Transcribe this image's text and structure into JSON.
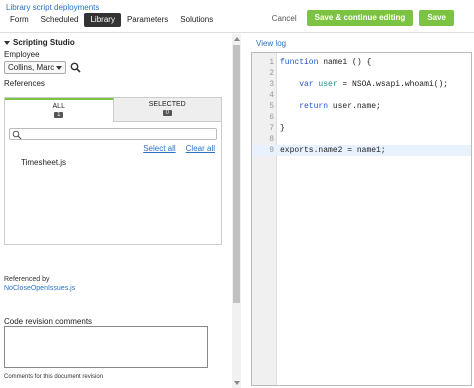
{
  "header": {
    "breadcrumb": "Library script deployments",
    "tabs": [
      "Form",
      "Scheduled",
      "Library",
      "Parameters",
      "Solutions"
    ],
    "active_tab": "Library",
    "cancel_label": "Cancel",
    "save_continue_label": "Save & continue editing",
    "save_label": "Save"
  },
  "left": {
    "section_title": "Scripting Studio",
    "employee_label": "Employee",
    "employee_value": "Collins, Marc",
    "references_label": "References",
    "ref_tabs": [
      {
        "label": "ALL",
        "count": "1"
      },
      {
        "label": "SELECTED",
        "count": "0"
      }
    ],
    "select_all": "Select all",
    "clear_all": "Clear all",
    "items": [
      "Timesheet.js"
    ],
    "referenced_by_label": "Referenced by",
    "referenced_by_link": "NoCloseOpenIssues.js",
    "revision_label": "Code revision comments",
    "revision_hint": "Comments for this document revision"
  },
  "right": {
    "view_log": "View log",
    "code_lines": [
      {
        "n": "1",
        "text": "function name1 () {"
      },
      {
        "n": "2",
        "text": ""
      },
      {
        "n": "3",
        "text": "    var user = NSOA.wsapi.whoami();"
      },
      {
        "n": "4",
        "text": ""
      },
      {
        "n": "5",
        "text": "    return user.name;"
      },
      {
        "n": "6",
        "text": ""
      },
      {
        "n": "7",
        "text": "}"
      },
      {
        "n": "8",
        "text": ""
      },
      {
        "n": "9",
        "text": "exports.name2 = name1;"
      }
    ],
    "highlighted_line": "9"
  },
  "colors": {
    "accent_green": "#7cc243",
    "link_blue": "#2a73c5",
    "keyword_blue": "#2255cc"
  }
}
